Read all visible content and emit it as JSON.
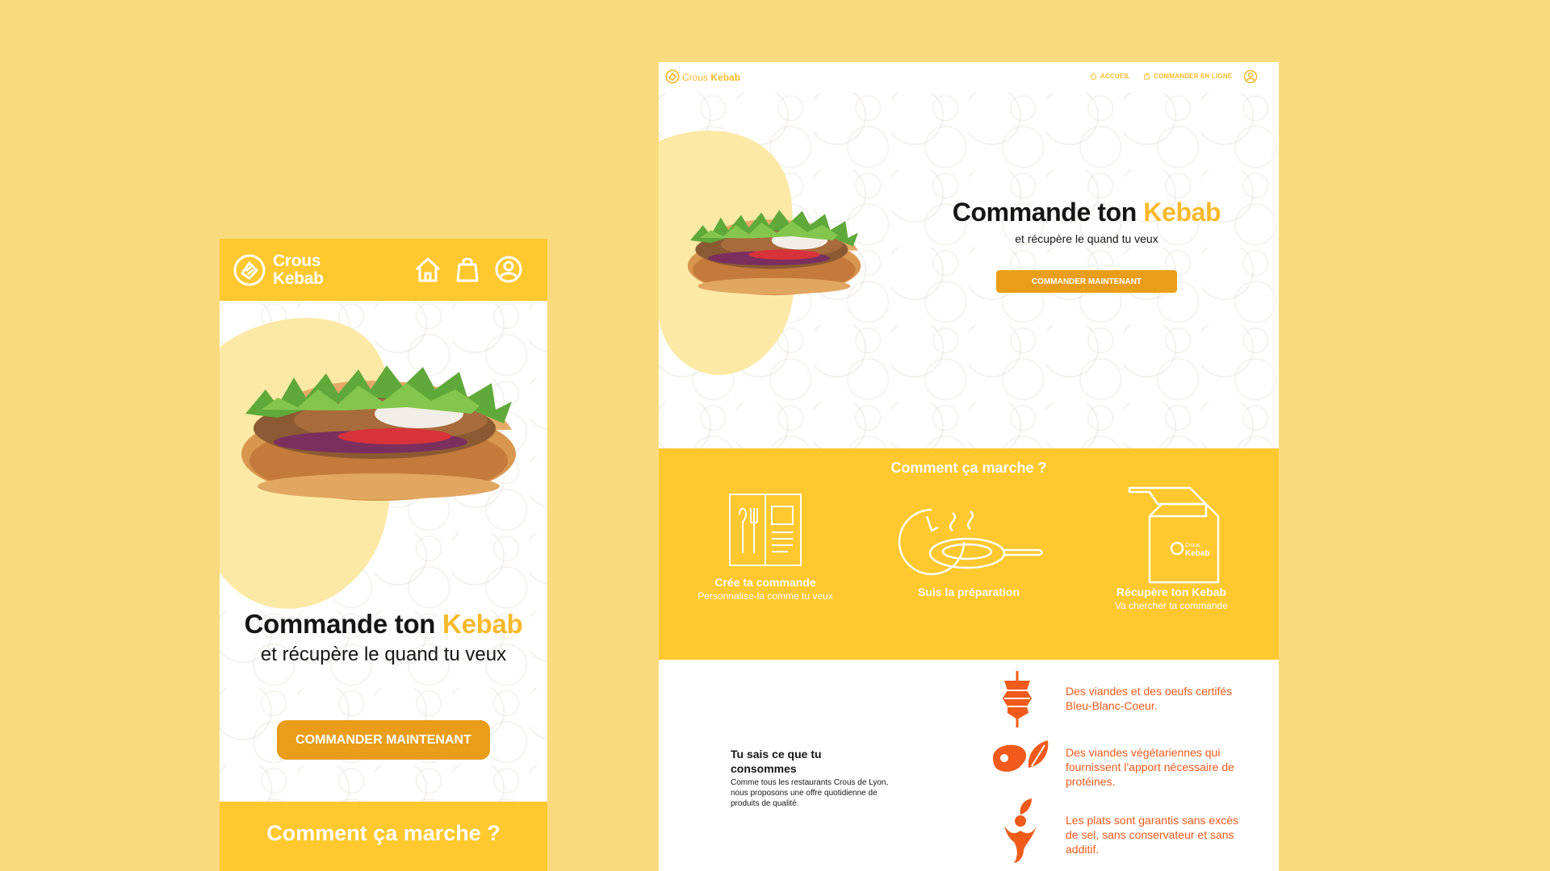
{
  "colors": {
    "background": "#f9db7d",
    "yellow": "#ffc82e",
    "accent_text": "#f8b929",
    "button": "#e99d18",
    "orange": "#f05a1a",
    "dark_text": "#151515"
  },
  "brand": {
    "line1": "Crous",
    "line2": "Kebab"
  },
  "hero": {
    "title_main": "Commande ton ",
    "title_accent": "Kebab",
    "subtitle": "et récupère le quand tu veux",
    "cta": "COMMANDER MAINTENANT",
    "image": "kebab-sandwich"
  },
  "mobile": {
    "nav_icons": [
      "home-icon",
      "bag-icon",
      "user-icon"
    ],
    "how_title": "Comment ça marche ?"
  },
  "desktop": {
    "nav": {
      "home": "ACCUEIL",
      "order_online": "COMMANDER EN LIGNE"
    },
    "how": {
      "title": "Comment ça marche ?",
      "steps": [
        {
          "title": "Crée ta commande",
          "desc": "Personnalise-la comme tu veux",
          "icon": "menu-book-icon"
        },
        {
          "title": "Suis la préparation",
          "desc": "",
          "icon": "pan-timer-icon"
        },
        {
          "title": "Récupère ton Kebab",
          "desc": "Va chercher ta commande",
          "icon": "takeaway-bag-icon"
        }
      ]
    },
    "info": {
      "title": "Tu sais ce que tu consommes",
      "desc": "Comme tous les restaurants Crous de Lyon, nous proposons une offre quotidienne de produits de qualité.",
      "features": [
        {
          "text": "Des viandes et des oeufs certifés Bleu-Blanc-Coeur.",
          "icon": "kebab-spit-icon"
        },
        {
          "text": "Des viandes végétariennes qui fournissent l'apport nécessaire de protéines.",
          "icon": "steak-leaf-icon"
        },
        {
          "text": "Les plats sont garantis sans excès de sel, sans conservateur et sans additif.",
          "icon": "healthy-person-icon"
        }
      ]
    }
  }
}
